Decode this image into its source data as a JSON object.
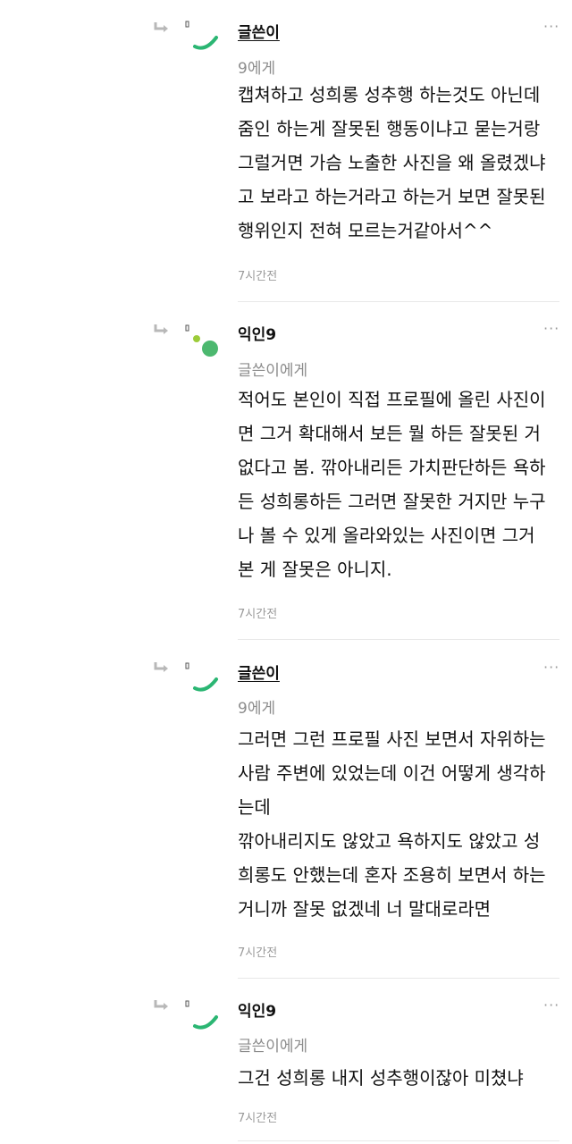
{
  "comments": [
    {
      "author": "글쓴이",
      "target": "9에게",
      "text": "캡쳐하고 성희롱 성추행 하는것도 아닌데\n줌인 하는게 잘못된 행동이냐고 묻는거랑\n그럴거면 가슴 노출한 사진을 왜 올렸겠냐\n고 보라고 하는거라고 하는거 보면 잘못된\n행위인지 전혀 모르는거같아서^^",
      "time": "7시간전",
      "more": "···"
    },
    {
      "author": "익인9",
      "target": "글쓴이에게",
      "text": "적어도 본인이 직접 프로필에 올린 사진이\n면 그거 확대해서 보든 뭘 하든 잘못된 거\n없다고 봄. 깎아내리든 가치판단하든 욕하\n든 성희롱하든 그러면 잘못한 거지만 누구\n나 볼 수 있게 올라와있는 사진이면 그거\n본 게 잘못은 아니지.",
      "time": "7시간전",
      "more": "···"
    },
    {
      "author": "글쓴이",
      "target": "9에게",
      "text": "그러면 그런 프로필 사진 보면서 자위하는\n사람 주변에 있었는데 이건 어떻게 생각하\n는데\n깎아내리지도 않았고 욕하지도 않았고 성\n희롱도 안했는데 혼자 조용히 보면서 하는\n거니까 잘못 없겠네 너 말대로라면",
      "time": "7시간전",
      "more": "···"
    },
    {
      "author": "익인9",
      "target": "글쓴이에게",
      "text": "그건 성희롱 내지 성추행이잖아 미쳤냐",
      "time": "7시간전",
      "more": "···"
    }
  ],
  "colors": {
    "accent_green": "#2bb673",
    "avatar_green": "#4cb86f",
    "dot_lime": "#9ccc3a"
  }
}
